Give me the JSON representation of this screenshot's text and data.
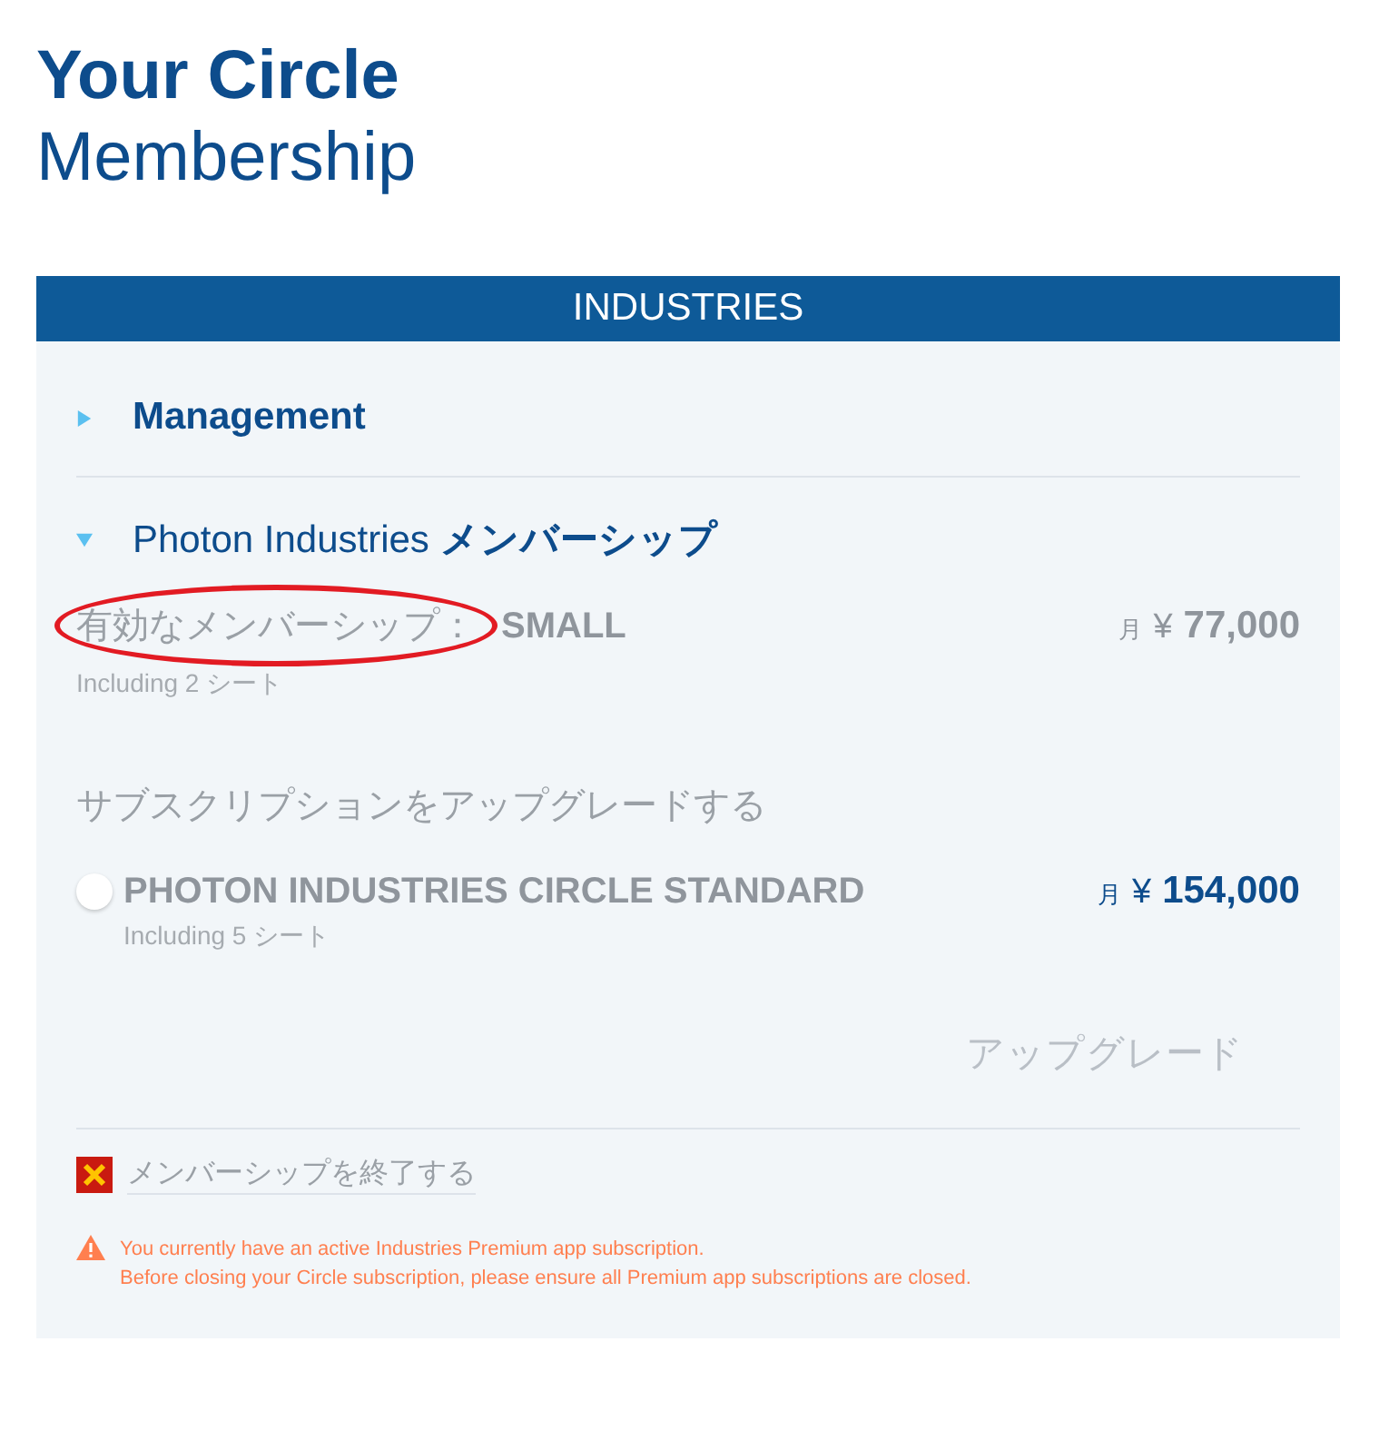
{
  "header": {
    "title": "Your Circle",
    "subtitle": "Membership"
  },
  "panel": {
    "heading": "INDUSTRIES",
    "sections": [
      {
        "title": "**Management**",
        "expanded": false
      },
      {
        "title": "Photon Industries **メンバーシップ**",
        "expanded": true
      }
    ],
    "current": {
      "label": "有効なメンバーシップ：",
      "plan": "SMALL",
      "period": "月",
      "currency": "¥",
      "price": "77,000",
      "seats": "Including 2 シート",
      "highlighted": true
    },
    "upgrade": {
      "heading": "サブスクリプションをアップグレードする",
      "options": [
        {
          "name": "PHOTON INDUSTRIES CIRCLE STANDARD",
          "seats": "Including 5 シート",
          "period": "月",
          "currency": "¥",
          "price": "154,000",
          "selected": false
        }
      ],
      "button": {
        "label": "アップグレード",
        "disabled": true
      }
    },
    "close_link": "メンバーシップを終了する",
    "warning": [
      "You currently have an active Industries Premium app subscription.",
      "Before closing your Circle subscription, please ensure all Premium app subscriptions are closed."
    ]
  }
}
